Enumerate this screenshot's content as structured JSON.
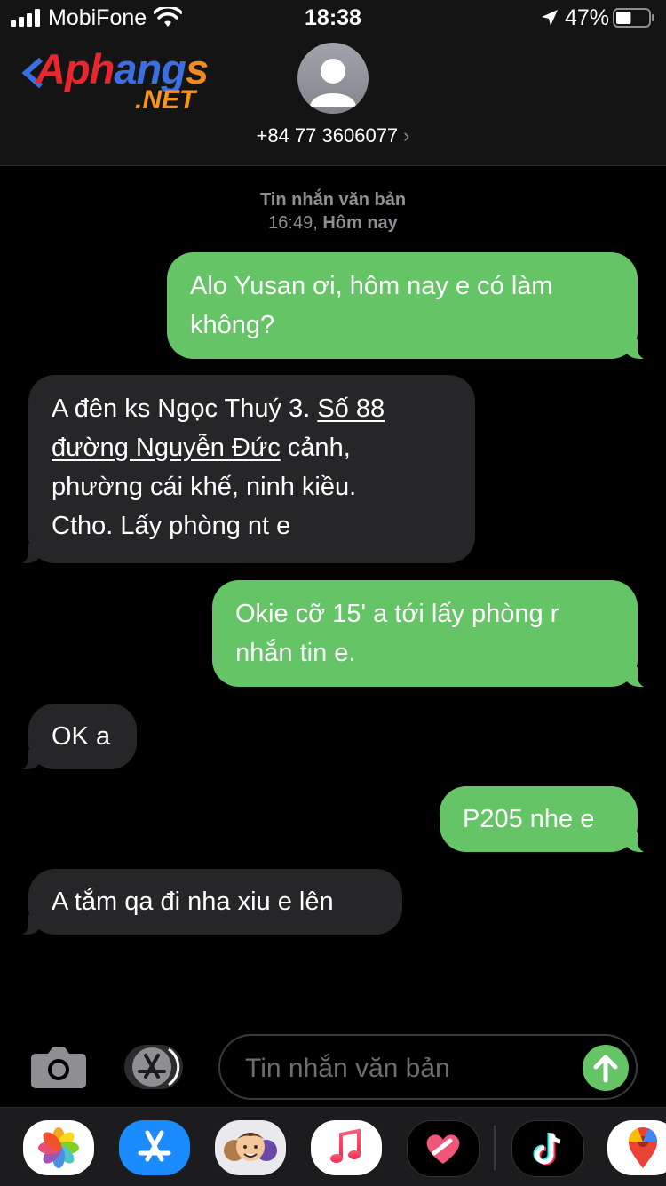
{
  "status_bar": {
    "carrier": "MobiFone",
    "time": "18:38",
    "battery": "47%",
    "battery_level": 0.47
  },
  "logo": {
    "main": "Aphangs",
    "suffix": ".NET"
  },
  "contact": {
    "phone": "+84 77 3606077",
    "chevron": "›"
  },
  "conversation": {
    "type_label": "Tin nhắn văn bản",
    "time": "16:49,",
    "day": "Hôm nay"
  },
  "messages": [
    {
      "direction": "out",
      "lines": [
        "Alo Yusan ơi, hôm nay e có làm",
        "không?"
      ]
    },
    {
      "direction": "in",
      "line1_a": "A đên ks Ngọc Thuý 3. ",
      "line1_link": "Số 88",
      "line2_link": "đường Nguyễn Đức",
      "line2_b": " cảnh,",
      "line3": "phường cái khế, ninh kiều.",
      "line4": "Ctho. Lấy phòng nt e"
    },
    {
      "direction": "out",
      "lines": [
        "Okie cỡ 15' a tới lấy phòng r",
        "nhắn tin e."
      ]
    },
    {
      "direction": "in",
      "lines": [
        "OK a"
      ]
    },
    {
      "direction": "out",
      "lines": [
        "P205 nhe e"
      ]
    },
    {
      "direction": "in",
      "lines": [
        "A tắm qa đi nha xiu e lên"
      ]
    }
  ],
  "compose": {
    "placeholder": "Tin nhắn văn bản",
    "value": ""
  },
  "icons": {
    "camera": "camera-icon",
    "appstore": "app-store-icon",
    "send": "send-arrow-icon"
  },
  "colors": {
    "outgoing_bubble": "#65c466",
    "incoming_bubble": "#262628",
    "header": "#141414"
  }
}
